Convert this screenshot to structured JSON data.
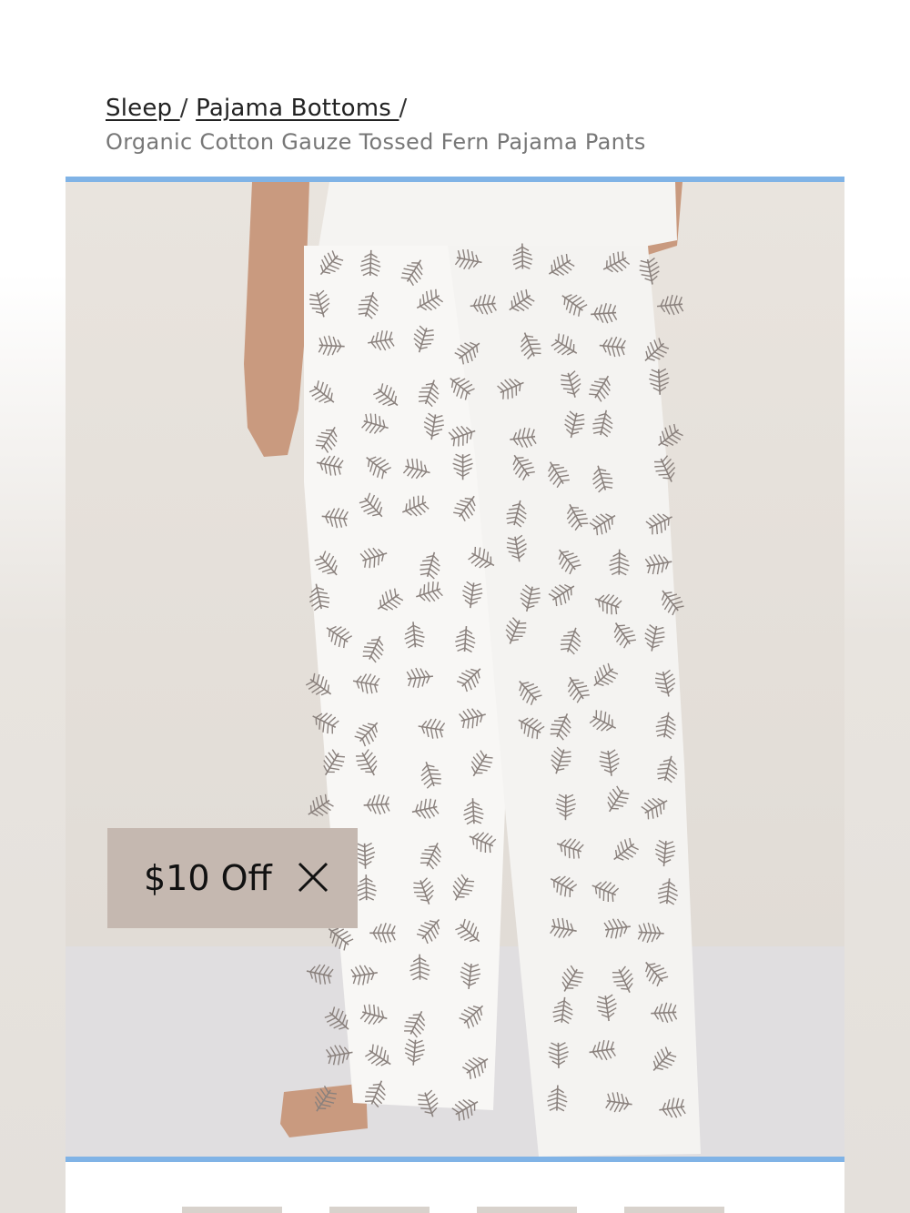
{
  "breadcrumb": {
    "items": [
      {
        "label": "Sleep "
      },
      {
        "label": "Pajama Bottoms "
      }
    ],
    "separator": "/",
    "current": "Organic Cotton Gauze Tossed Fern Pajama Pants"
  },
  "product_image": {
    "subject": "pajama-pants-tossed-fern-print",
    "colors": {
      "background_wall": "#e7e2dc",
      "floor": "#e1dfe1",
      "fabric": "#f7f6f4",
      "print": "#8a817d",
      "skin": "#c99a7f",
      "frame_border": "#80b3e6"
    }
  },
  "promo": {
    "label": "$10 Off",
    "close_icon": "close-icon",
    "background": "#c5b8b0"
  },
  "thumbnails": {
    "count_visible": 4
  }
}
